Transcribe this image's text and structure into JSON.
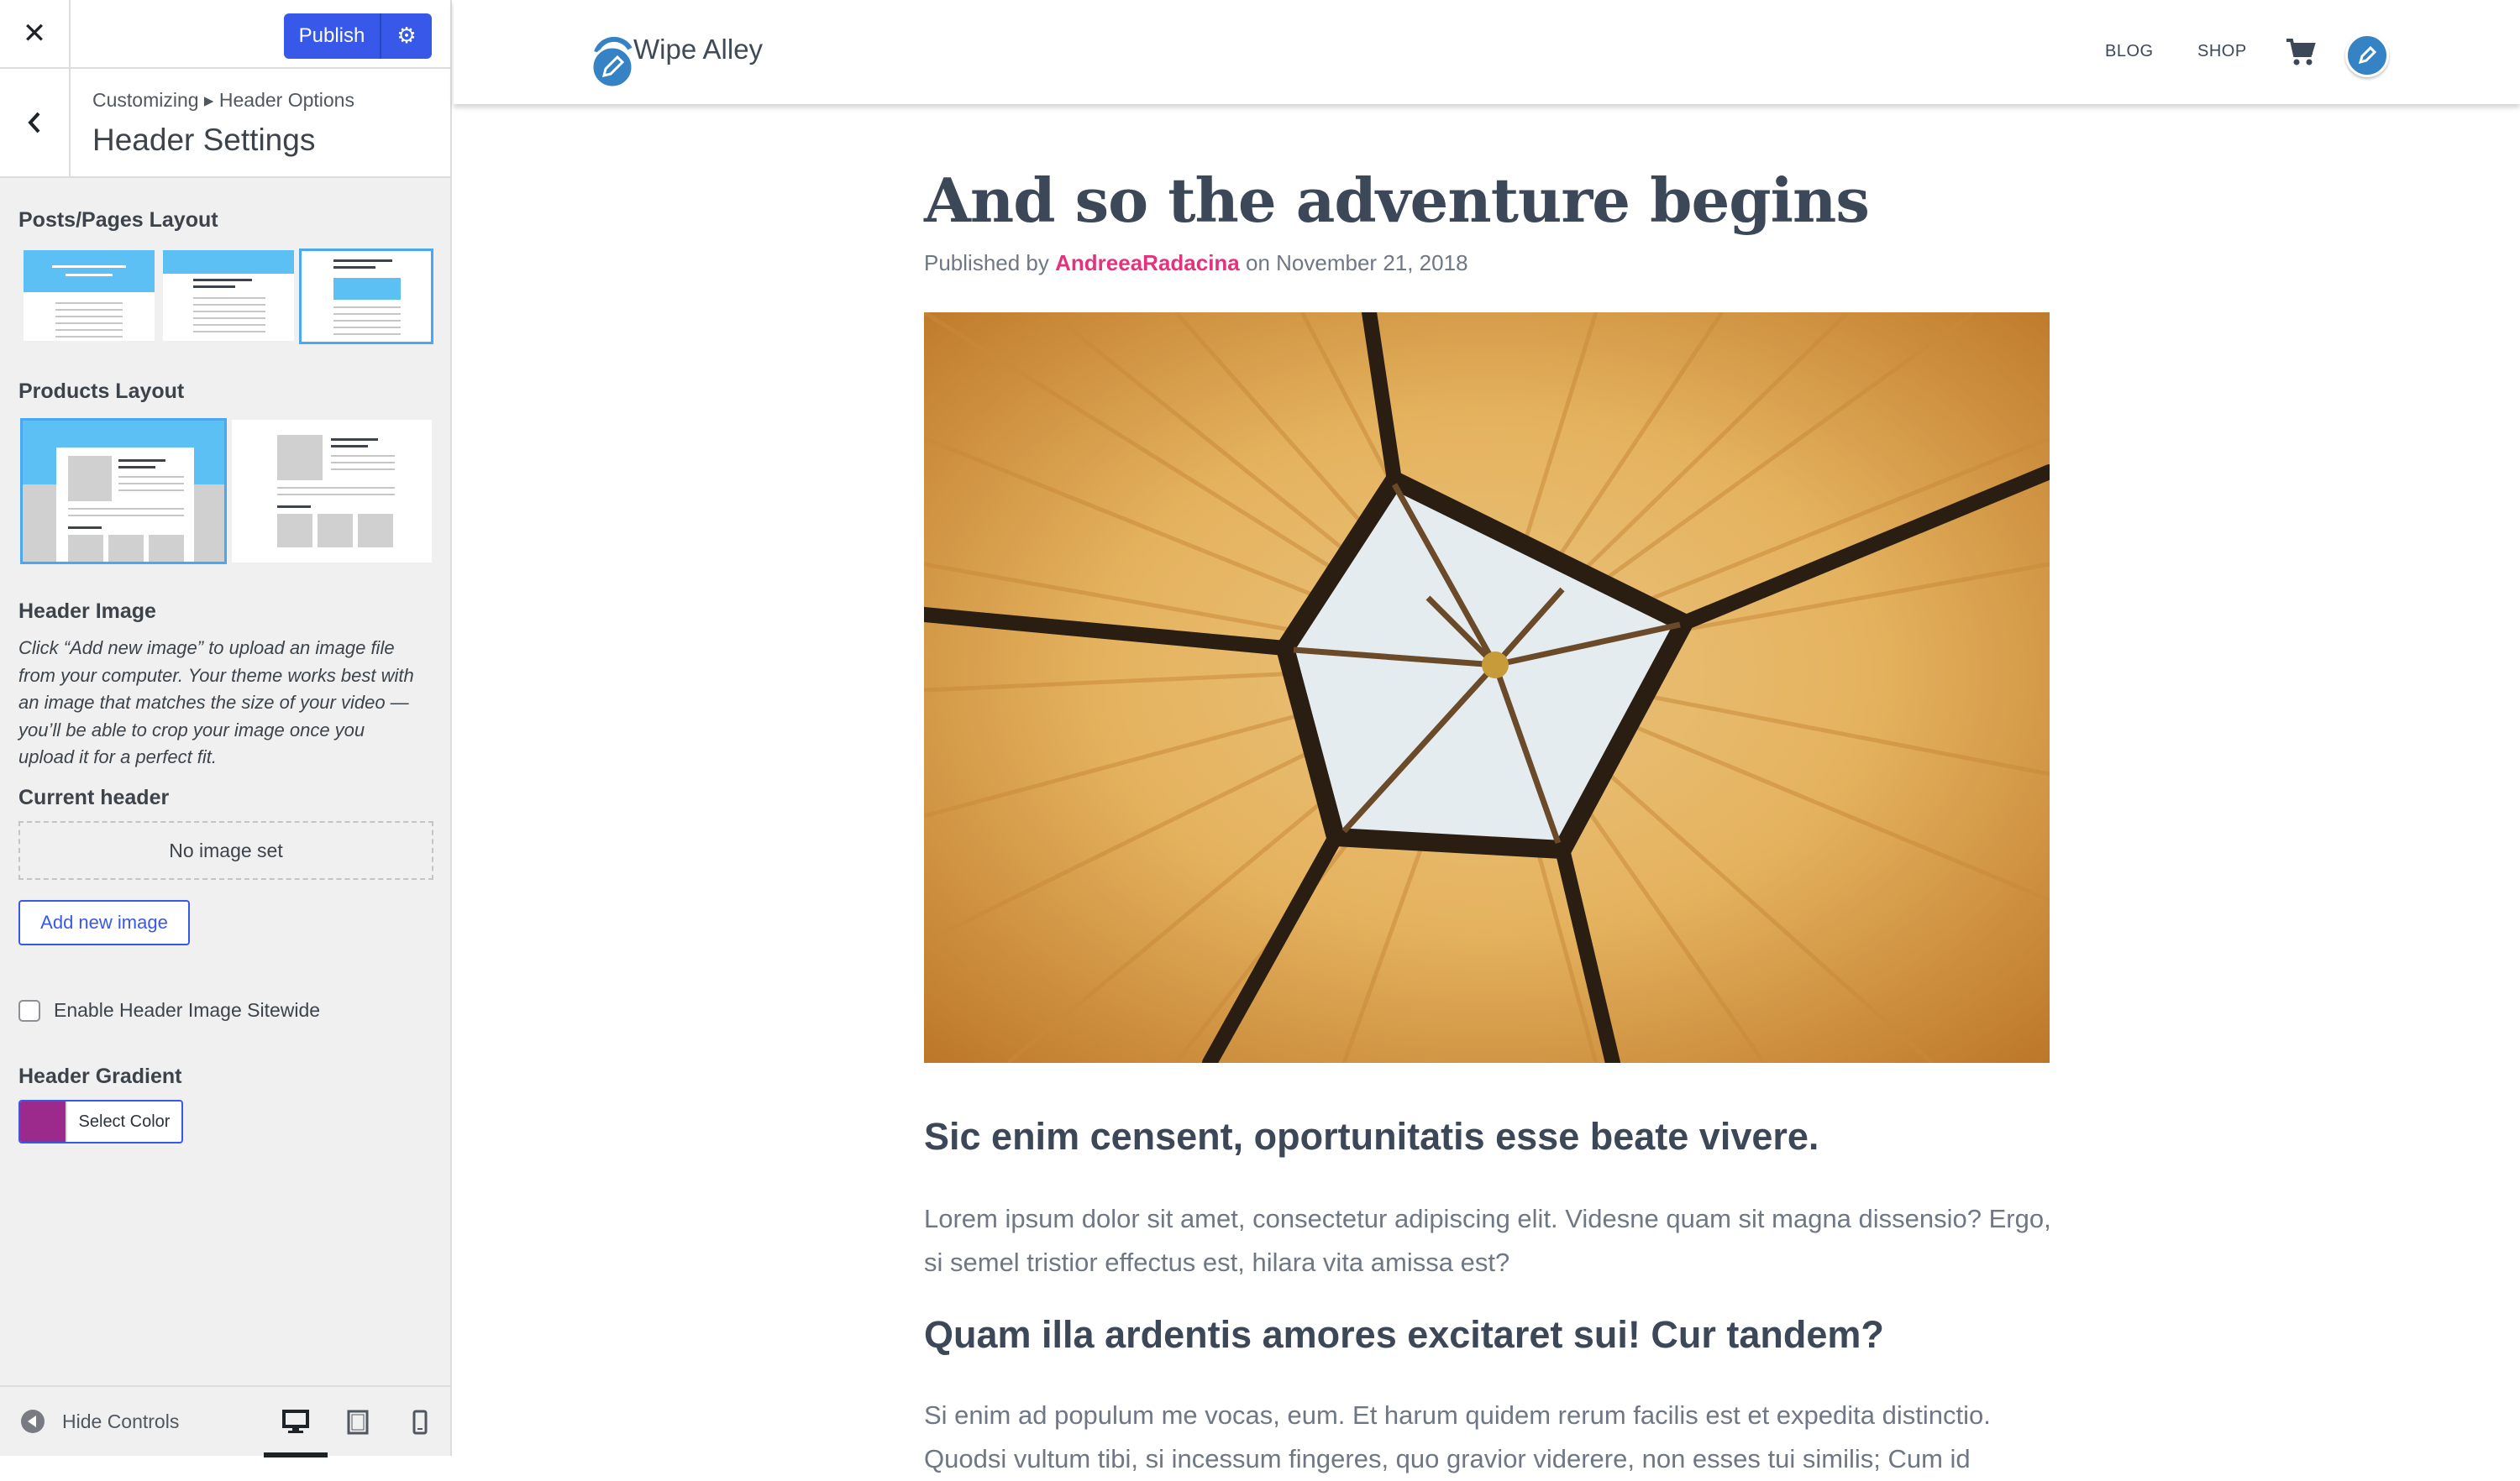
{
  "sidebar": {
    "publish_label": "Publish",
    "breadcrumb": "Customizing ▸ Header Options",
    "panel_title": "Header Settings",
    "posts_layout_title": "Posts/Pages Layout",
    "products_layout_title": "Products Layout",
    "header_image_title": "Header Image",
    "header_image_desc": "Click “Add new image” to upload an image file from your computer. Your theme works best with an image that matches the size of your video — you’ll be able to crop your image once you upload it for a perfect fit.",
    "current_header_title": "Current header",
    "no_image_text": "No image set",
    "add_image_label": "Add new image",
    "sitewide_label": "Enable Header Image Sitewide",
    "sitewide_checked": false,
    "gradient_title": "Header Gradient",
    "gradient_color": "#9c2a8c",
    "select_color_label": "Select Color",
    "hide_controls_label": "Hide Controls",
    "selected_device": "desktop"
  },
  "site": {
    "title": "Wipe Alley",
    "nav": [
      "BLOG",
      "SHOP"
    ],
    "accent": "#3582c4"
  },
  "post": {
    "title": "And so the adventure begins",
    "byline_prefix": "Published by",
    "author": "AndreeaRadacina",
    "byline_suffix": "on November 21, 2018",
    "heading1": "Sic enim censent, oportunitatis esse beate vivere.",
    "para1": "Lorem ipsum dolor sit amet, consectetur adipiscing elit. Videsne quam sit magna dissensio? Ergo, si semel tristior effectus est, hilara vita amissa est?",
    "heading2": "Quam illa ardentis amores excitaret sui! Cur tandem?",
    "para2": "Si enim ad populum me vocas, eum. Et harum quidem rerum facilis est et expedita distinctio. Quodsi vultum tibi, si incessum fingeres, quo gravior viderere, non esses tui similis; Cum id"
  }
}
